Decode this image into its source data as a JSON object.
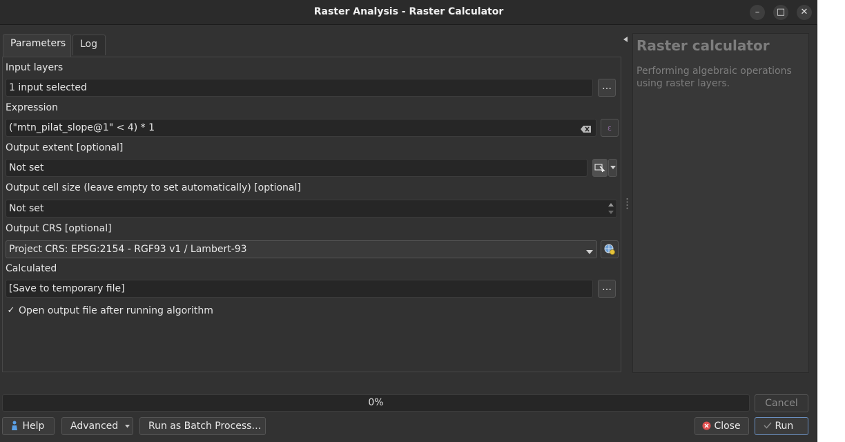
{
  "window": {
    "title": "Raster Analysis - Raster Calculator",
    "controls": {
      "minimize": "–",
      "maximize": "□",
      "close": "✕"
    }
  },
  "tabs": [
    {
      "label": "Parameters",
      "active": true
    },
    {
      "label": "Log",
      "active": false
    }
  ],
  "params": {
    "input_layers": {
      "label": "Input layers",
      "value": "1 input selected",
      "button": "…"
    },
    "expression": {
      "label": "Expression",
      "value": "(\"mtn_pilat_slope@1\" < 4) * 1"
    },
    "output_extent": {
      "label": "Output extent [optional]",
      "value": "Not set"
    },
    "cell_size": {
      "label": "Output cell size (leave empty to set automatically) [optional]",
      "value": "Not set"
    },
    "output_crs": {
      "label": "Output CRS [optional]",
      "value": "Project CRS: EPSG:2154 - RGF93 v1 / Lambert-93"
    },
    "calculated": {
      "label": "Calculated",
      "value": "[Save to temporary file]",
      "button": "…"
    },
    "open_output": {
      "label": "Open output file after running algorithm",
      "checked": true,
      "check_glyph": "✓"
    }
  },
  "help_panel": {
    "title": "Raster calculator",
    "description": "Performing algebraic operations using raster layers."
  },
  "progress": {
    "value": 0,
    "text": "0%"
  },
  "buttons": {
    "cancel": "Cancel",
    "help": "Help",
    "advanced": "Advanced",
    "batch": "Run as Batch Process…",
    "close": "Close",
    "run": "Run"
  },
  "colors": {
    "window_bg": "#323232",
    "field_bg": "#262626",
    "help_text": "#7d7d7d",
    "close_icon": "#e05050",
    "help_icon": "#5aa0e6"
  }
}
